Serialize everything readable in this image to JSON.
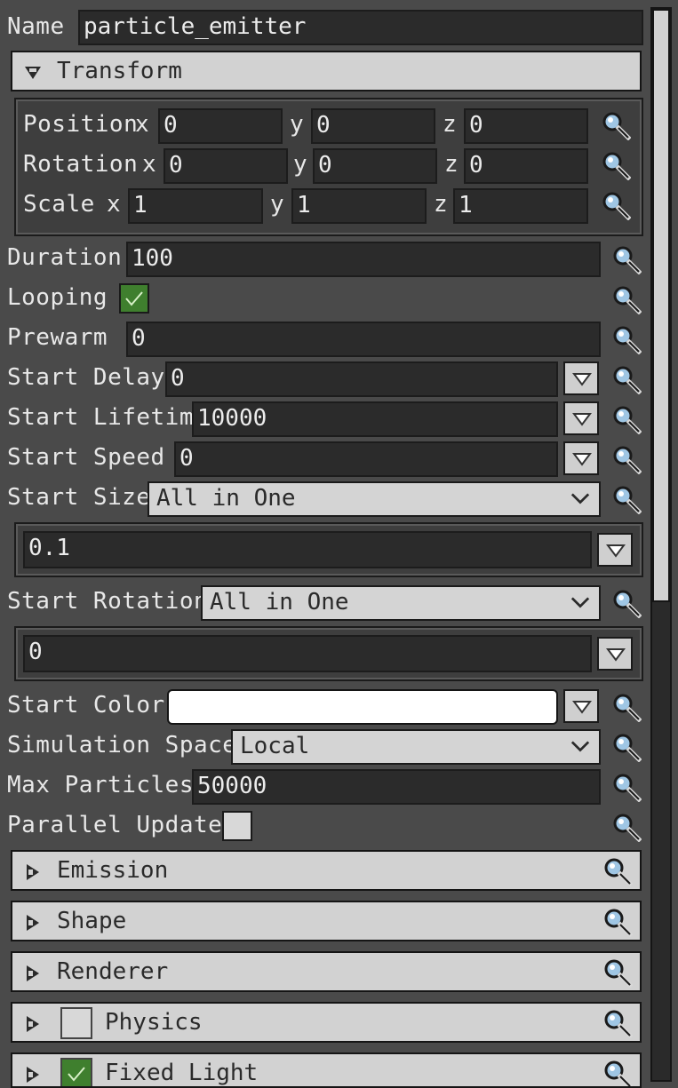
{
  "name": {
    "label": "Name",
    "value": "particle_emitter"
  },
  "transform": {
    "title": "Transform",
    "rows": [
      {
        "label": "Position",
        "x": "0",
        "y": "0",
        "z": "0"
      },
      {
        "label": "Rotation",
        "x": "0",
        "y": "0",
        "z": "0"
      },
      {
        "label": "Scale",
        "x": "1",
        "y": "1",
        "z": "1"
      }
    ],
    "axis": {
      "x": "x",
      "y": "y",
      "z": "z"
    }
  },
  "props": {
    "duration": {
      "label": "Duration",
      "value": "100"
    },
    "looping": {
      "label": "Looping",
      "checked": true
    },
    "prewarm": {
      "label": "Prewarm",
      "value": "0"
    },
    "start_delay": {
      "label": "Start Delay",
      "value": "0"
    },
    "start_lifetime": {
      "label": "Start Lifetime",
      "value": "10000"
    },
    "start_speed": {
      "label": "Start Speed",
      "value": "0"
    },
    "start_size": {
      "label": "Start Size",
      "mode": "All in One",
      "value": "0.1"
    },
    "start_rotation": {
      "label": "Start Rotation",
      "mode": "All in One",
      "value": "0"
    },
    "start_color": {
      "label": "Start Color",
      "color": "#ffffff"
    },
    "simulation_space": {
      "label": "Simulation Space",
      "value": "Local"
    },
    "max_particles": {
      "label": "Max Particles",
      "value": "50000"
    },
    "parallel_update": {
      "label": "Parallel Update",
      "checked": false
    }
  },
  "sections": {
    "emission": "Emission",
    "shape": "Shape",
    "renderer": "Renderer",
    "physics": {
      "label": "Physics",
      "checked": false
    },
    "fixed_light": {
      "label": "Fixed Light",
      "checked": true
    }
  },
  "icons": {
    "search": "magnifier-icon",
    "dropdown": "chevron-down-icon",
    "collapse": "triangle-icon"
  },
  "colors": {
    "bg": "#4a4a4a",
    "field": "#2b2b2b",
    "header": "#d2d2d2",
    "check_on": "#3f7f2e"
  }
}
